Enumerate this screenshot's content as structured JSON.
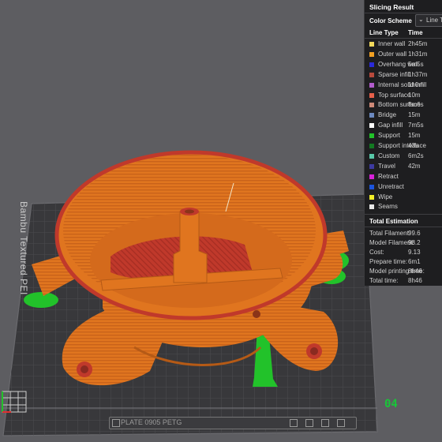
{
  "plate": {
    "label": "Bambu Textured PEI",
    "number": "04",
    "bottom_text": "PLATE 0905 PETG"
  },
  "panel": {
    "title": "Slicing Result",
    "color_scheme_label": "Color Scheme",
    "color_scheme_value": "Line Type",
    "col_line_type": "Line Type",
    "col_time": "Time",
    "line_types": [
      {
        "name": "Inner wall",
        "time": "2h45m",
        "color": "#f2d95c"
      },
      {
        "name": "Outer wall",
        "time": "1h31m",
        "color": "#f0a023"
      },
      {
        "name": "Overhang wall",
        "time": "5m5s",
        "color": "#2a2ad8"
      },
      {
        "name": "Sparse infill",
        "time": "1h37m",
        "color": "#b84a3c"
      },
      {
        "name": "Internal solid infill",
        "time": "1h0m",
        "color": "#b25ccc"
      },
      {
        "name": "Top surface",
        "time": "10m",
        "color": "#e6604a"
      },
      {
        "name": "Bottom surface",
        "time": "8m6s",
        "color": "#ce8a78"
      },
      {
        "name": "Bridge",
        "time": "15m",
        "color": "#6c8ac0"
      },
      {
        "name": "Gap infill",
        "time": "7m5s",
        "color": "#ffffff"
      },
      {
        "name": "Support",
        "time": "15m",
        "color": "#22c22a"
      },
      {
        "name": "Support interface",
        "time": "43s",
        "color": "#137a22"
      },
      {
        "name": "Custom",
        "time": "6m2s",
        "color": "#58c8a8"
      },
      {
        "name": "Travel",
        "time": "42m",
        "color": "#3d3aa0"
      },
      {
        "name": "Retract",
        "time": "",
        "color": "#d822d8"
      },
      {
        "name": "Unretract",
        "time": "",
        "color": "#1c54dc"
      },
      {
        "name": "Wipe",
        "time": "",
        "color": "#f2ee28"
      },
      {
        "name": "Seams",
        "time": "",
        "color": "#e8e8e8"
      }
    ],
    "estimation_title": "Total Estimation",
    "estimation": [
      {
        "name": "Total Filament:",
        "value": "99.6"
      },
      {
        "name": "Model Filament:",
        "value": "98.2"
      },
      {
        "name": "Cost:",
        "value": "9.13"
      },
      {
        "name": "Prepare time:",
        "value": "6m1"
      },
      {
        "name": "Model printing time:",
        "value": "8h46"
      },
      {
        "name": "Total time:",
        "value": "8h46"
      }
    ]
  },
  "colors": {
    "background": "#5d5d61",
    "plate": "#3a3a3d",
    "model_orange": "#e0751f",
    "top_red": "#c0392b",
    "support_green": "#22c22a",
    "panel_bg": "#1e1e20"
  }
}
